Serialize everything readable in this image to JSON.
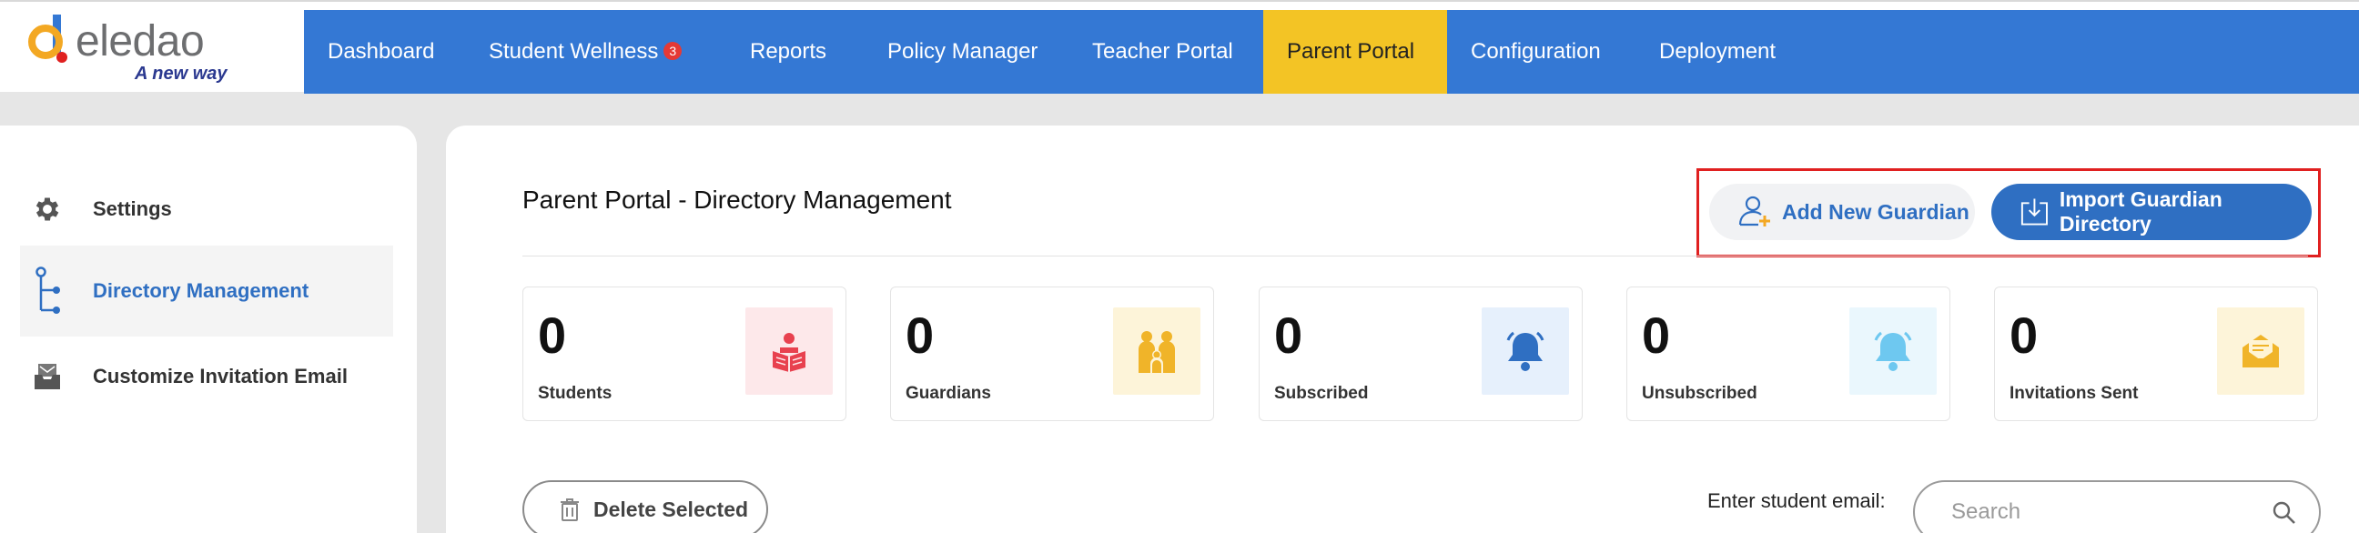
{
  "logo": {
    "brand": "eledao",
    "tagline": "A new way"
  },
  "nav": {
    "items": [
      {
        "label": "Dashboard"
      },
      {
        "label": "Student Wellness",
        "badge": "3"
      },
      {
        "label": "Reports"
      },
      {
        "label": "Policy Manager"
      },
      {
        "label": "Teacher Portal"
      },
      {
        "label": "Parent Portal",
        "active": true
      },
      {
        "label": "Configuration"
      },
      {
        "label": "Deployment"
      }
    ]
  },
  "sidebar": {
    "items": [
      {
        "label": "Settings",
        "icon": "gear-icon"
      },
      {
        "label": "Directory Management",
        "icon": "tree-icon",
        "active": true
      },
      {
        "label": "Customize Invitation Email",
        "icon": "mail-tray-icon"
      }
    ]
  },
  "main": {
    "title": "Parent Portal - Directory Management",
    "add_guardian_label": "Add New Guardian",
    "import_label": "Import Guardian Directory",
    "stats": [
      {
        "value": "0",
        "label": "Students",
        "icon": "reading-student-icon",
        "color": "#e8414f",
        "bg": "#fde8ea"
      },
      {
        "value": "0",
        "label": "Guardians",
        "icon": "family-icon",
        "color": "#f0b429",
        "bg": "#fdf4d9"
      },
      {
        "value": "0",
        "label": "Subscribed",
        "icon": "bell-icon",
        "color": "#2f6fc2",
        "bg": "#e6f0fc"
      },
      {
        "value": "0",
        "label": "Unsubscribed",
        "icon": "bell-off-icon",
        "color": "#6ec8f0",
        "bg": "#eaf7fd"
      },
      {
        "value": "0",
        "label": "Invitations Sent",
        "icon": "open-envelope-icon",
        "color": "#f0b429",
        "bg": "#fdf4d9"
      }
    ],
    "delete_label": "Delete Selected",
    "email_label": "Enter student email:",
    "search_placeholder": "Search"
  },
  "colors": {
    "nav": "#3478d4",
    "active_nav": "#f3c425",
    "accent": "#2f6fc2",
    "highlight": "#e02020"
  }
}
